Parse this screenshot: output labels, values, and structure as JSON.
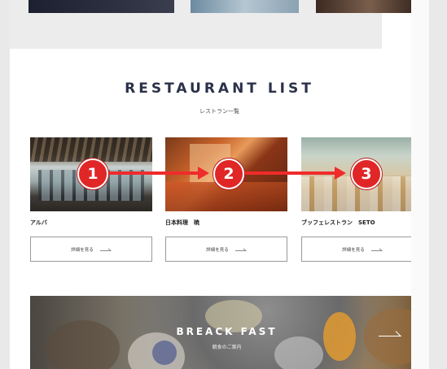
{
  "section": {
    "title": "RESTAURANT LIST",
    "subtitle": "レストラン一覧"
  },
  "restaurants": [
    {
      "name": "アルバ",
      "button_label": "詳細を見る"
    },
    {
      "name": "日本料理　暁",
      "button_label": "詳細を見る"
    },
    {
      "name": "ブッフェレストラン　SETO",
      "button_label": "詳細を見る"
    }
  ],
  "breakfast": {
    "title": "BREACK FAST",
    "subtitle": "朝食のご案内"
  },
  "annotations": [
    {
      "label": "1"
    },
    {
      "label": "2"
    },
    {
      "label": "3"
    }
  ],
  "colors": {
    "title_navy": "#2a3148",
    "annotation_red": "#e02626"
  }
}
